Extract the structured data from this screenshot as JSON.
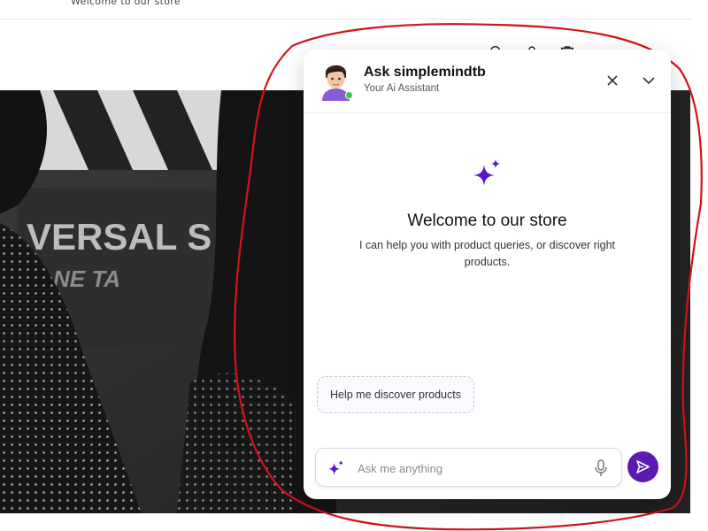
{
  "store": {
    "announcement": "Welcome to our store",
    "header_icons": [
      "search-icon",
      "account-icon",
      "cart-icon"
    ]
  },
  "hero": {
    "sign_text": "VERSAL S",
    "sign_text_lower": "NE TA"
  },
  "chat": {
    "title": "Ask simplemindtb",
    "subtitle": "Your Ai Assistant",
    "status": "online",
    "welcome_title": "Welcome to our store",
    "welcome_text": "I can help you with product queries, or discover right products.",
    "suggestions": [
      "Help me discover products"
    ],
    "input": {
      "placeholder": "Ask me anything",
      "value": ""
    },
    "icons": {
      "close": "close-icon",
      "collapse": "chevron-down-icon",
      "sparkle": "sparkle-icon",
      "mic": "microphone-icon",
      "send": "send-icon"
    }
  },
  "colors": {
    "accent": "#5b1bb3",
    "sparkle": "#5a16c8",
    "online": "#2ecc40",
    "annotation": "#d0141a"
  }
}
